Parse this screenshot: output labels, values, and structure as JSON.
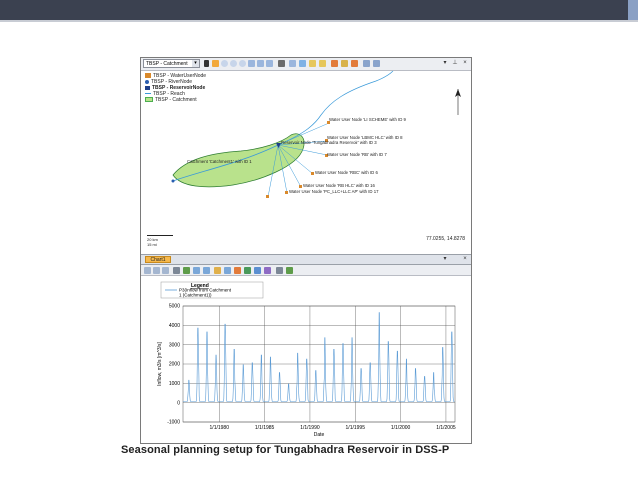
{
  "map_window": {
    "layer_combo": "TBSP - Catchment",
    "legend": [
      {
        "label": "TBSP - WaterUserNode",
        "color": "#d9892b"
      },
      {
        "label": "TBSP - RiverNode",
        "color": "#2a5db0"
      },
      {
        "label": "TBSP - ReservoirNode",
        "color": "#1e3f8a"
      },
      {
        "label": "TBSP - Reach",
        "color": "#3a9ad9"
      },
      {
        "label": "TBSP - Catchment",
        "color": "#4caf50"
      }
    ],
    "labels": {
      "node9": "Water User Node 'LI SCHEME' with ID 9",
      "node8": "Water User Node 'LBMC HLC' with ID 8",
      "reservoir": "Reservoir Node 'Tungabhadra Reservoir' with ID 3",
      "node7": "Water User Node 'RB' with ID 7",
      "catchment": "Catchment 'Catchment1' with ID 1",
      "node6": "Water User Node 'RBC' with ID 6",
      "node16": "Water User Node 'RB HLC' with ID 16",
      "node17": "Water User Node 'PC_LLC+LLC AP' with ID 17"
    },
    "scale_text_1": "20 km",
    "scale_text_2": "15 mi",
    "coords": "77.0255, 14.8278"
  },
  "chart_tab": "Chart1",
  "caption": "Seasonal planning setup  for Tungabhadra Reservoir in DSS-P",
  "colors": {
    "series": "#5b9bd5",
    "catchment_fill": "#b9e28c",
    "catchment_stroke": "#2e7d32",
    "reach": "#3a9ad9",
    "topbar": "#3b4150"
  },
  "chart_data": {
    "type": "line",
    "title": "Legend",
    "xlabel": "Date",
    "ylabel": "Inflow, m3/s [m^3/s]",
    "ylim": [
      -1000,
      5000
    ],
    "yticks": [
      -1000,
      0,
      1000,
      2000,
      3000,
      4000,
      5000
    ],
    "xticks": [
      "1/1/1980",
      "1/1/1985",
      "1/1/1990",
      "1/1/1995",
      "1/1/2000",
      "1/1/2005"
    ],
    "xlim": [
      1976,
      2006
    ],
    "series": [
      {
        "name": "P3(Inflow from Catchment 1 (Catchment1))",
        "annual_peaks": [
          [
            1976,
            1100
          ],
          [
            1977,
            3800
          ],
          [
            1978,
            3600
          ],
          [
            1979,
            2400
          ],
          [
            1980,
            4000
          ],
          [
            1981,
            2700
          ],
          [
            1982,
            1900
          ],
          [
            1983,
            2000
          ],
          [
            1984,
            2400
          ],
          [
            1985,
            2300
          ],
          [
            1986,
            1500
          ],
          [
            1987,
            900
          ],
          [
            1988,
            2500
          ],
          [
            1989,
            2200
          ],
          [
            1990,
            1600
          ],
          [
            1991,
            3300
          ],
          [
            1992,
            2700
          ],
          [
            1993,
            3000
          ],
          [
            1994,
            3300
          ],
          [
            1995,
            1700
          ],
          [
            1996,
            2000
          ],
          [
            1997,
            4600
          ],
          [
            1998,
            3100
          ],
          [
            1999,
            2600
          ],
          [
            2000,
            2200
          ],
          [
            2001,
            1700
          ],
          [
            2002,
            1300
          ],
          [
            2003,
            1500
          ],
          [
            2004,
            2800
          ],
          [
            2005,
            3600
          ]
        ]
      }
    ]
  }
}
